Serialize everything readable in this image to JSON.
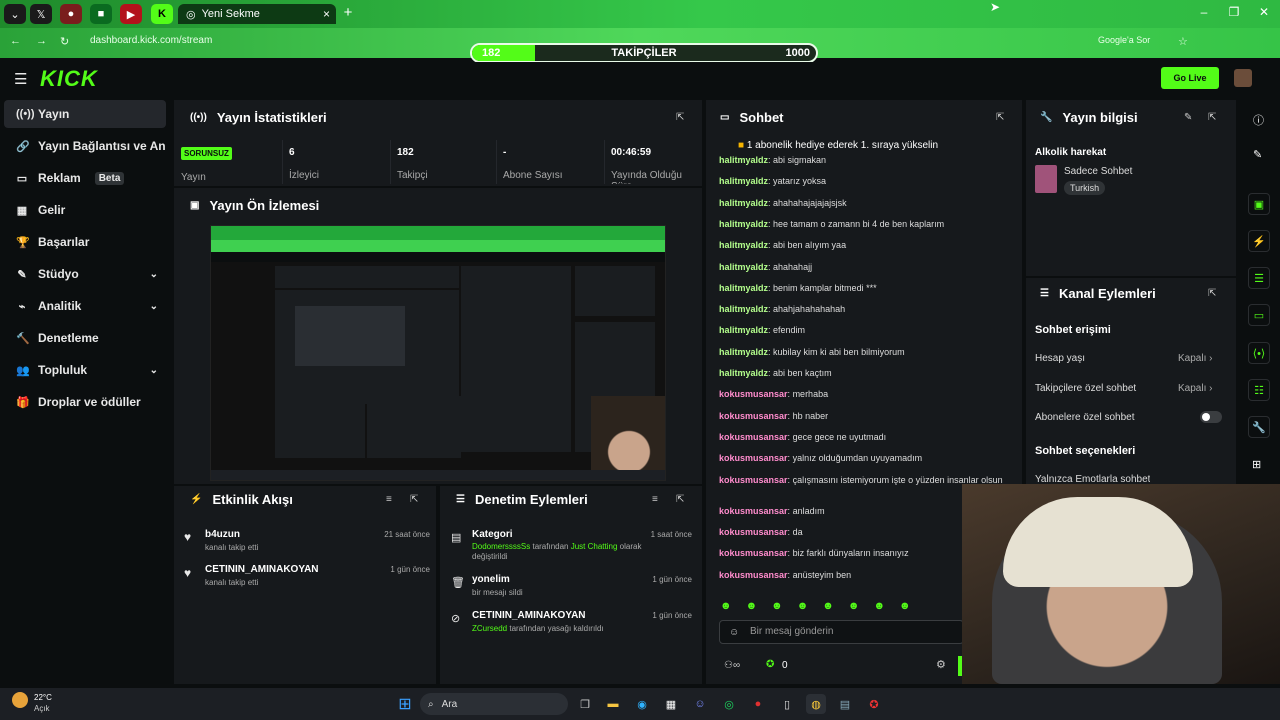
{
  "browser": {
    "active_tab_title": "Yeni Sekme",
    "url": "dashboard.kick.com/stream",
    "google_label": "Google'a Sor"
  },
  "overlay": {
    "followers_current": "182",
    "followers_title": "TAKİPÇİLER",
    "followers_goal": "1000",
    "progress_fraction": 0.182
  },
  "header": {
    "logo": "KICK",
    "go_live": "Go Live"
  },
  "sidebar": {
    "items": [
      {
        "label": "Yayın",
        "icon": "broadcast-icon"
      },
      {
        "label": "Yayın Bağlantısı ve Anahtarı",
        "icon": "link-icon"
      },
      {
        "label": "Reklam",
        "badge": "Beta",
        "icon": "ad-icon"
      },
      {
        "label": "Gelir",
        "icon": "revenue-icon"
      },
      {
        "label": "Başarılar",
        "icon": "trophy-icon"
      },
      {
        "label": "Stüdyo",
        "icon": "studio-icon"
      },
      {
        "label": "Analitik",
        "icon": "analytics-icon"
      },
      {
        "label": "Denetleme",
        "icon": "moderation-icon"
      },
      {
        "label": "Topluluk",
        "icon": "community-icon"
      },
      {
        "label": "Droplar ve ödüller",
        "icon": "drops-icon"
      }
    ]
  },
  "stats": {
    "title": "Yayın İstatistikleri",
    "problem_badge": "SORUNSUZ",
    "stream_label": "Yayın",
    "cells": [
      {
        "value": "6",
        "label": "İzleyici"
      },
      {
        "value": "182",
        "label": "Takipçi"
      },
      {
        "value": "-",
        "label": "Abone Sayısı"
      },
      {
        "value": "00:46:59",
        "label": "Yayında Olduğu Süre"
      }
    ]
  },
  "preview": {
    "title": "Yayın Ön İzlemesi"
  },
  "activity": {
    "title": "Etkinlik Akışı",
    "items": [
      {
        "name": "b4uzun",
        "desc": "kanalı takip etti",
        "time": "21 saat önce"
      },
      {
        "name": "CETININ_AMINAKOYAN",
        "desc": "kanalı takip etti",
        "time": "1 gün önce"
      }
    ]
  },
  "moderation": {
    "title": "Denetim Eylemleri",
    "items": [
      {
        "title": "Kategori",
        "user": "DodomerssssSs",
        "mid": " tarafından ",
        "target": "Just Chatting",
        "rest": " olarak değiştirildi",
        "time": "1 saat önce"
      },
      {
        "title": "yonelim",
        "rest": "bir mesajı sildi",
        "time": "1 gün önce"
      },
      {
        "title": "CETININ_AMINAKOYAN",
        "user": "ZCursedd",
        "rest": " tarafından yasağı kaldırıldı",
        "time": "1 gün önce"
      }
    ]
  },
  "chat": {
    "title": "Sohbet",
    "pinned": "1 abonelik hediye ederek 1. sıraya yükselin",
    "input_placeholder": "Bir mesaj gönderin",
    "points": "0",
    "messages": [
      {
        "user": "halitmyaldz",
        "text": "abi sigmakan"
      },
      {
        "user": "halitmyaldz",
        "text": "yatarız yoksa"
      },
      {
        "user": "halitmyaldz",
        "text": "ahahahajajajajsjsk"
      },
      {
        "user": "halitmyaldz",
        "text": "hee tamam o zamann bi 4 de ben kaplarım"
      },
      {
        "user": "halitmyaldz",
        "text": "abi ben alıyım yaa"
      },
      {
        "user": "halitmyaldz",
        "text": "ahahahajj"
      },
      {
        "user": "halitmyaldz",
        "text": "benim kamplar bitmedi ***"
      },
      {
        "user": "halitmyaldz",
        "text": "ahahjahahahahah"
      },
      {
        "user": "halitmyaldz",
        "text": "efendim"
      },
      {
        "user": "halitmyaldz",
        "text": "kubilay kim ki abi ben bilmiyorum"
      },
      {
        "user": "halitmyaldz",
        "text": "abi ben kaçtım"
      },
      {
        "user": "kokusmusansar",
        "text": "merhaba"
      },
      {
        "user": "kokusmusansar",
        "text": "hb naber"
      },
      {
        "user": "kokusmusansar",
        "text": "gece gece ne uyutmadı"
      },
      {
        "user": "kokusmusansar",
        "text": "yalnız olduğumdan uyuyamadım"
      },
      {
        "user": "kokusmusansar",
        "text": "çalışmasını istemiyorum işte o yüzden insanlar olsun"
      },
      {
        "user": "kokusmusansar",
        "text": "anladım"
      },
      {
        "user": "kokusmusansar",
        "text": "da"
      },
      {
        "user": "kokusmusansar",
        "text": "biz farklı dünyaların insanıyız"
      },
      {
        "user": "kokusmusansar",
        "text": "anüsteyim ben"
      }
    ]
  },
  "stream_info": {
    "title": "Yayın bilgisi",
    "stream_title": "Alkolik harekat",
    "category": "Sadece Sohbet",
    "tag": "Turkish"
  },
  "channel_actions": {
    "title": "Kanal Eylemleri",
    "chat_access": "Sohbet erişimi",
    "account_age": "Hesap yaşı",
    "account_age_val": "Kapalı",
    "follower_only": "Takipçilere özel sohbet",
    "follower_only_val": "Kapalı",
    "sub_only": "Abonelere özel sohbet",
    "chat_options": "Sohbet seçenekleri",
    "emote_only": "Yalnızca Emotlarla sohbet"
  },
  "taskbar": {
    "weather_temp": "22°C",
    "weather_state": "Açık",
    "search": "Ara"
  }
}
